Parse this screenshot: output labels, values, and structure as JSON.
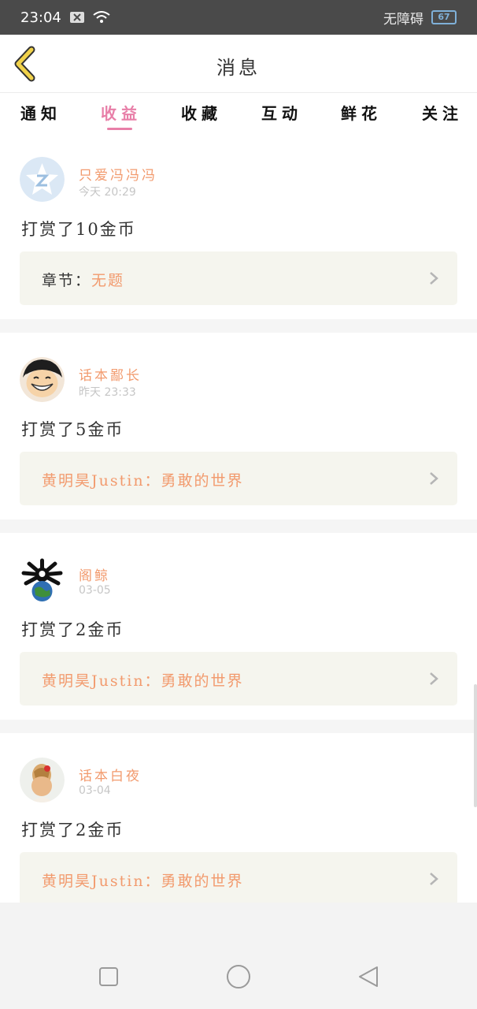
{
  "status_bar": {
    "time": "23:04",
    "accessibility_label": "无障碍",
    "battery": "67"
  },
  "header": {
    "title": "消息"
  },
  "tabs": [
    {
      "label": "通知"
    },
    {
      "label": "收益"
    },
    {
      "label": "收藏"
    },
    {
      "label": "互动"
    },
    {
      "label": "鲜花"
    },
    {
      "label": "关注"
    }
  ],
  "active_tab": "收益",
  "messages": [
    {
      "user": "只爱冯冯冯",
      "time": "今天 20:29",
      "text": "打赏了10金币",
      "detail_label": "章节：",
      "detail_value": "无题",
      "avatar_icon": "qq-default-avatar-icon"
    },
    {
      "user": "话本鄙长",
      "time": "昨天 23:33",
      "text": "打赏了5金币",
      "detail_label": "",
      "detail_value": "黄明昊Justin：勇敢的世界",
      "avatar_icon": "anime-boy-avatar-icon"
    },
    {
      "user": "阁鲸",
      "time": "03-05",
      "text": "打赏了2金币",
      "detail_label": "",
      "detail_value": "黄明昊Justin：勇敢的世界",
      "avatar_icon": "globe-avatar-icon"
    },
    {
      "user": "话本白夜",
      "time": "03-04",
      "text": "打赏了2金币",
      "detail_label": "",
      "detail_value": "黄明昊Justin：勇敢的世界",
      "avatar_icon": "girl-avatar-icon"
    }
  ],
  "colors": {
    "accent_pink": "#e87fa8",
    "username_orange": "#f29a6d",
    "detail_box_bg": "#f5f5ee",
    "back_arrow_yellow": "#f1d24a"
  }
}
